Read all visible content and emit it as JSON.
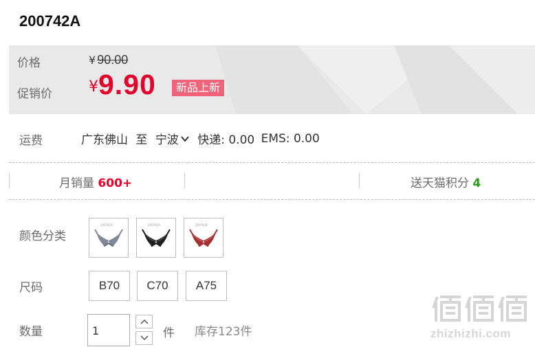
{
  "product": {
    "code": "200742A"
  },
  "price": {
    "label": "价格",
    "currency": "¥",
    "original": "90.00",
    "promo_label": "促销价",
    "promo": "9.90",
    "badge": "新品上新"
  },
  "shipping": {
    "label": "运费",
    "from": "广东佛山",
    "to_word": "至",
    "destination": "宁波",
    "express": "快递: 0.00",
    "ems": "EMS: 0.00"
  },
  "stats": {
    "monthly_sales_label": "月销量",
    "monthly_sales_value": "600+",
    "points_label": "送天猫积分",
    "points_value": "4"
  },
  "options": {
    "color_label": "颜色分类",
    "colors": [
      {
        "name": "gray",
        "hex": "#7e8995"
      },
      {
        "name": "black",
        "hex": "#1e1e1e"
      },
      {
        "name": "wine-red",
        "hex": "#a5302f"
      }
    ],
    "size_label": "尺码",
    "sizes": [
      "B70",
      "C70",
      "A75"
    ]
  },
  "quantity": {
    "label": "数量",
    "value": "1",
    "unit": "件",
    "stock": "库存123件"
  },
  "watermark": {
    "logo_text": "值值值",
    "url": "zhizhizhi.com"
  },
  "colors": {
    "accent_red": "#e4002b",
    "badge_pink": "#ef6478",
    "points_green": "#2e9a1f",
    "panel_gray": "#e9e9e9"
  }
}
